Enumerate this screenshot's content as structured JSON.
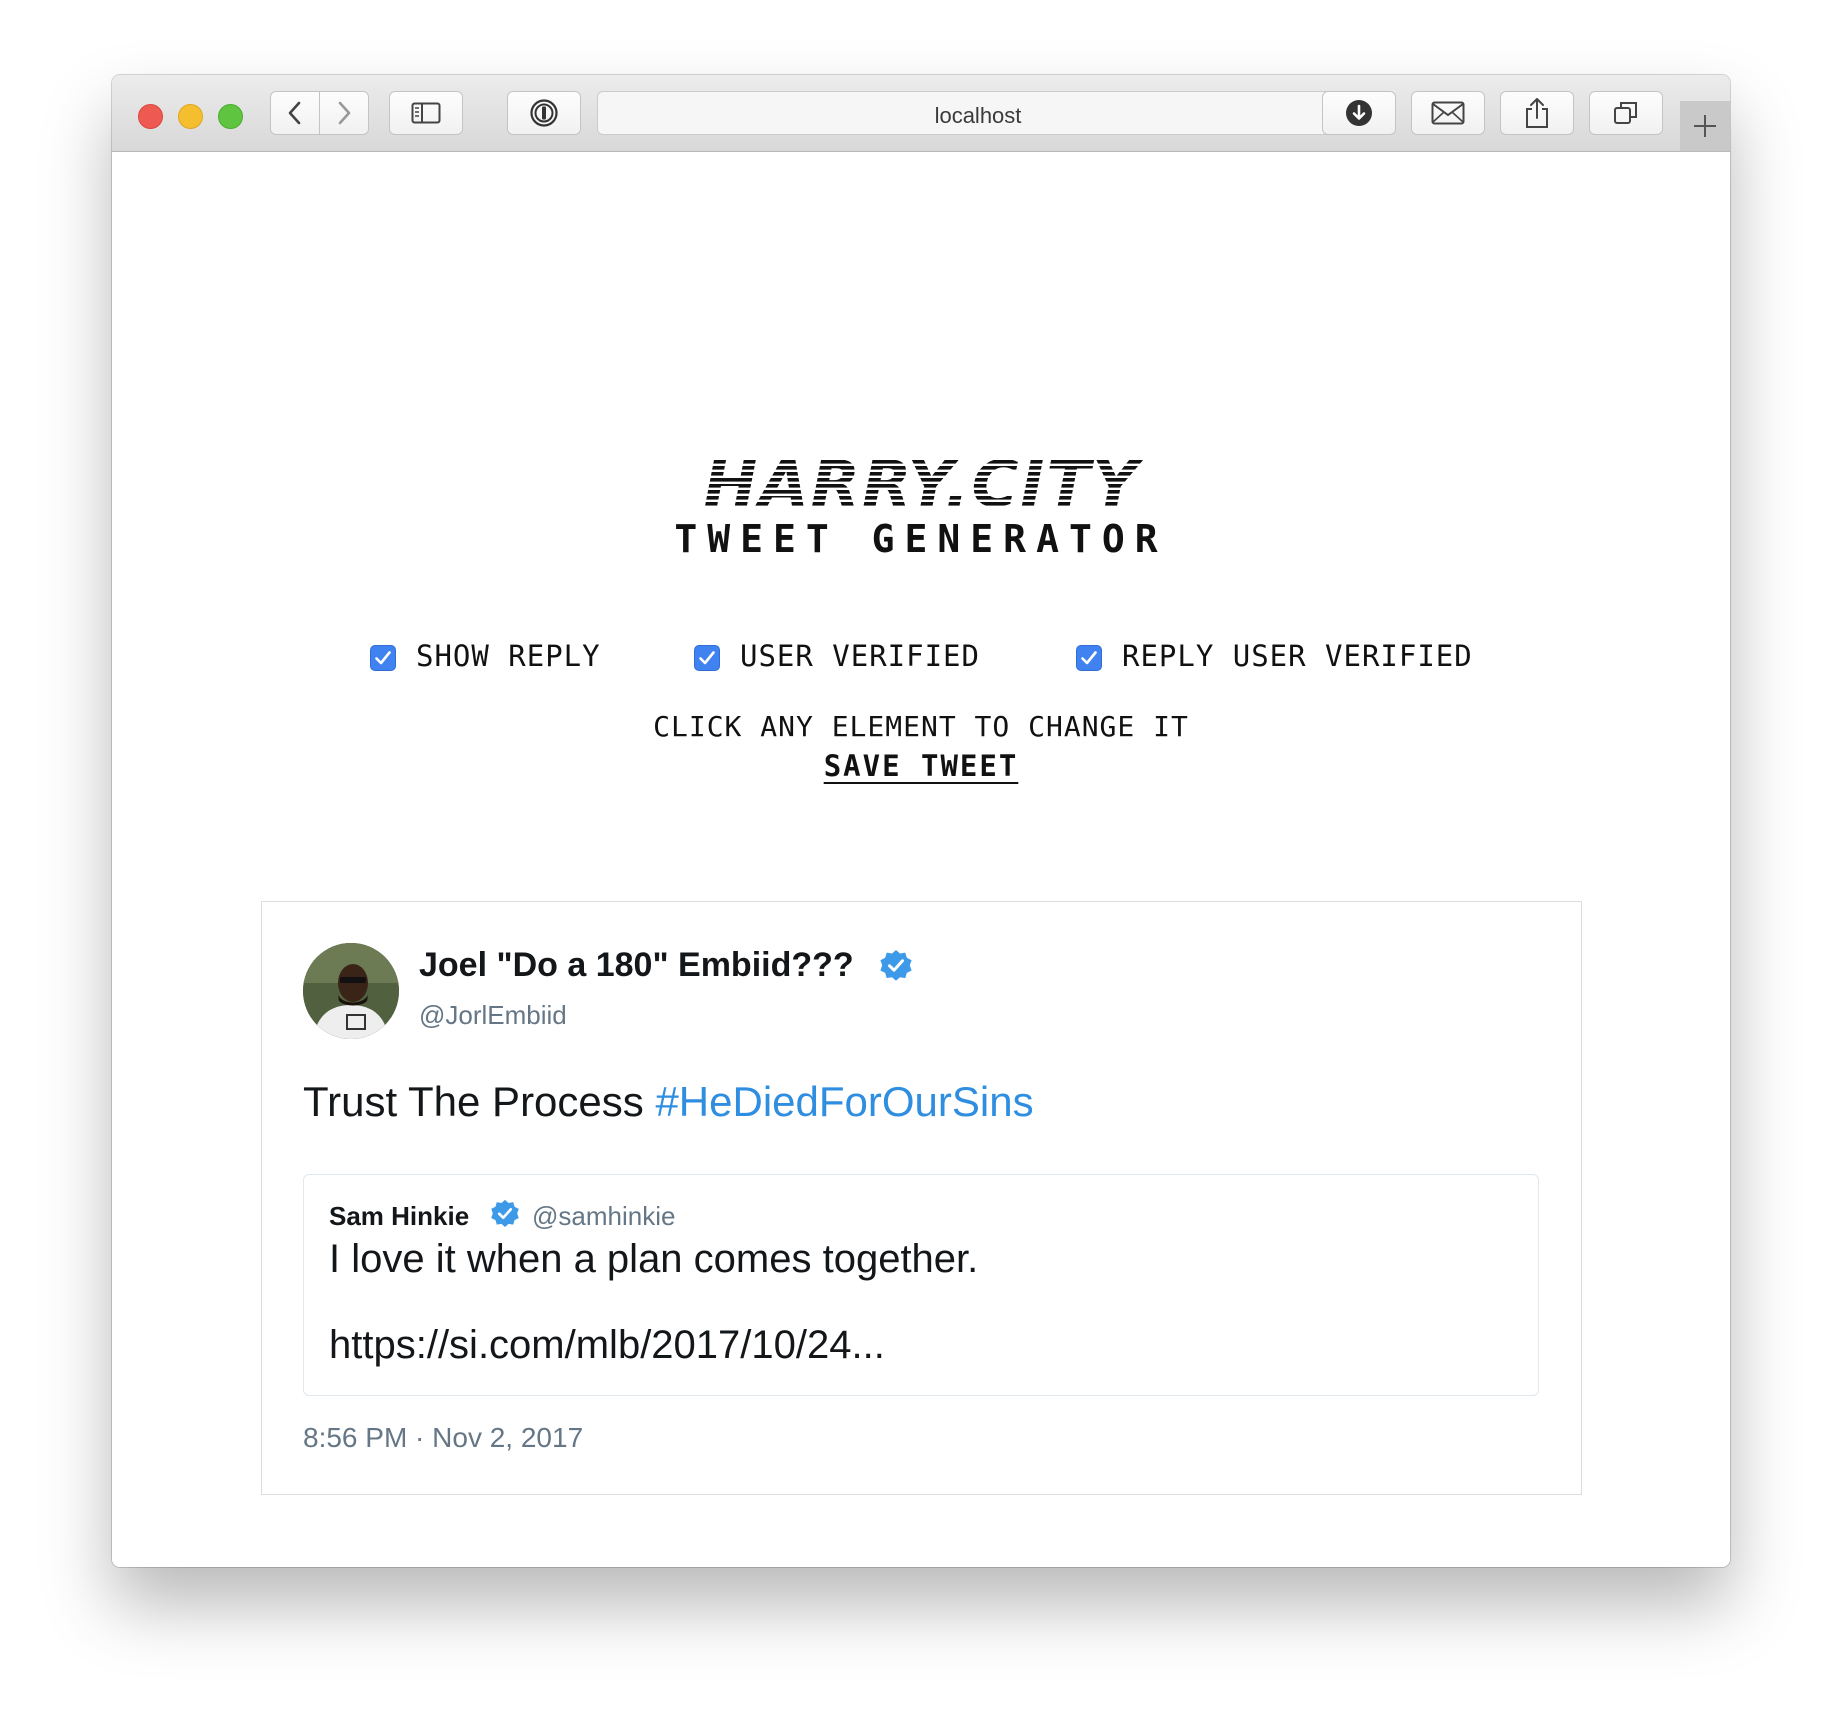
{
  "browser": {
    "address": "localhost"
  },
  "header": {
    "logo_text": "HARRY.CITY",
    "subtitle": "TWEET GENERATOR"
  },
  "options": [
    {
      "label": "SHOW REPLY",
      "checked": true
    },
    {
      "label": "USER VERIFIED",
      "checked": true
    },
    {
      "label": "REPLY USER VERIFIED",
      "checked": true
    }
  ],
  "hint": "CLICK ANY ELEMENT TO CHANGE IT",
  "save_label": "SAVE TWEET",
  "tweet": {
    "display_name": "Joel \"Do a 180\" Embiid???",
    "handle": "@JorlEmbiid",
    "verified": true,
    "text": "Trust The Process ",
    "hashtag": "#HeDiedForOurSins",
    "timestamp": "8:56 PM · Nov 2, 2017",
    "reply": {
      "name": "Sam Hinkie",
      "handle": "@samhinkie",
      "verified": true,
      "line1": "I love it when a plan comes together.",
      "line2": "https://si.com/mlb/2017/10/24..."
    }
  },
  "colors": {
    "accent": "#3f82f0",
    "verified": "#1da1f2",
    "hashtag": "#2f8ee0",
    "muted": "#657786"
  }
}
